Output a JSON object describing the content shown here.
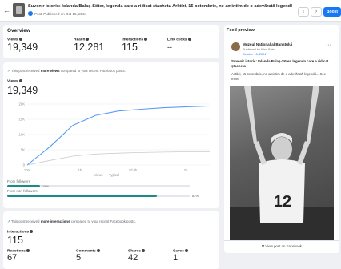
{
  "header": {
    "post_title": "Suvenir istoric: Iolanda Balaș-Söter, legenda care a ridicat ștacheta Arktízi, 15 octombrie, ne amintim de o adevărată legendă...",
    "post_type": "Post",
    "published": "Published on Oct 15, 2024",
    "boost_label": "Boost",
    "prev_icon": "chevron-left-icon",
    "next_icon": "chevron-right-icon"
  },
  "overview": {
    "title": "Overview",
    "metrics": [
      {
        "label": "Views",
        "value": "19,349"
      },
      {
        "label": "Reach",
        "value": "12,281"
      },
      {
        "label": "Interactions",
        "value": "115"
      },
      {
        "label": "Link clicks",
        "value": "--"
      }
    ]
  },
  "views_section": {
    "note_prefix": "This post received ",
    "note_bold": "more views",
    "note_suffix": " compared to your recent Facebook posts.",
    "label": "Views",
    "value": "19,349",
    "legend_views": "Views",
    "legend_typical": "Typical",
    "from_followers_label": "From followers",
    "from_followers_pct": "18%",
    "from_non_followers_label": "From non-followers",
    "from_non_followers_pct": "82%"
  },
  "chart_data": {
    "type": "line",
    "x_ticks": [
      "10m",
      "1h",
      "1d 0h",
      "7d"
    ],
    "y_ticks": [
      "0",
      "5K",
      "10K",
      "15K",
      "20K"
    ],
    "ylim": [
      0,
      20000
    ],
    "series": [
      {
        "name": "Views",
        "color": "#5b9bf3",
        "values": [
          0,
          6000,
          13000,
          16300,
          17700,
          18300,
          18800,
          19100,
          19349
        ]
      },
      {
        "name": "Typical",
        "color": "#c8ccd1",
        "values": [
          0,
          1500,
          2900,
          3600,
          3900,
          4100,
          4250,
          4350,
          4400
        ]
      }
    ]
  },
  "interactions_section": {
    "note_prefix": "This post received ",
    "note_bold": "more interactions",
    "note_suffix": " compared to your recent Facebook posts.",
    "label": "Interactions",
    "value": "115",
    "metrics": [
      {
        "label": "Reactions",
        "value": "67"
      },
      {
        "label": "Comments",
        "value": "5"
      },
      {
        "label": "Shares",
        "value": "42"
      },
      {
        "label": "Saves",
        "value": "1"
      }
    ]
  },
  "preview": {
    "title": "Feed preview",
    "page_name": "Muzeul Național al Banatului",
    "published_by": "Published by Alina Bâtu",
    "date": "October 15, 2024",
    "post_heading": "Suvenir istoric: Iolanda Balaș-Söter, legenda care a ridicat ștacheta",
    "post_text": "Astăzi, 15 octombrie, ne amintim de o adevărată legendă... See more",
    "view_link": "View post on Facebook",
    "more_icon": "more-options-icon"
  }
}
